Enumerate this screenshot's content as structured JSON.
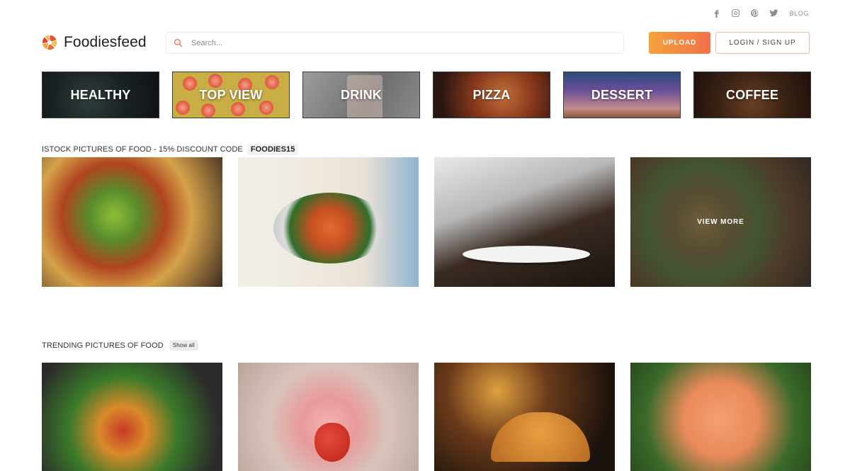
{
  "social": {
    "icons": [
      "facebook-icon",
      "instagram-icon",
      "pinterest-icon",
      "twitter-icon"
    ],
    "blog_label": "BLOG"
  },
  "brand": {
    "name": "Foodiesfeed",
    "accent": "#f2704a"
  },
  "search": {
    "placeholder": "Search..."
  },
  "header": {
    "upload_label": "UPLOAD",
    "login_label": "LOGIN / SIGN UP"
  },
  "categories": [
    {
      "label": "HEALTHY"
    },
    {
      "label": "TOP VIEW"
    },
    {
      "label": "DRINK"
    },
    {
      "label": "PIZZA"
    },
    {
      "label": "DESSERT"
    },
    {
      "label": "COFFEE"
    }
  ],
  "istock": {
    "title": "ISTOCK PICTURES OF FOOD - 15% DISCOUNT CODE",
    "code": "FOODIES15",
    "view_more": "VIEW MORE"
  },
  "trending": {
    "title": "TRENDING PICTURES OF FOOD",
    "show_all": "Show all"
  }
}
